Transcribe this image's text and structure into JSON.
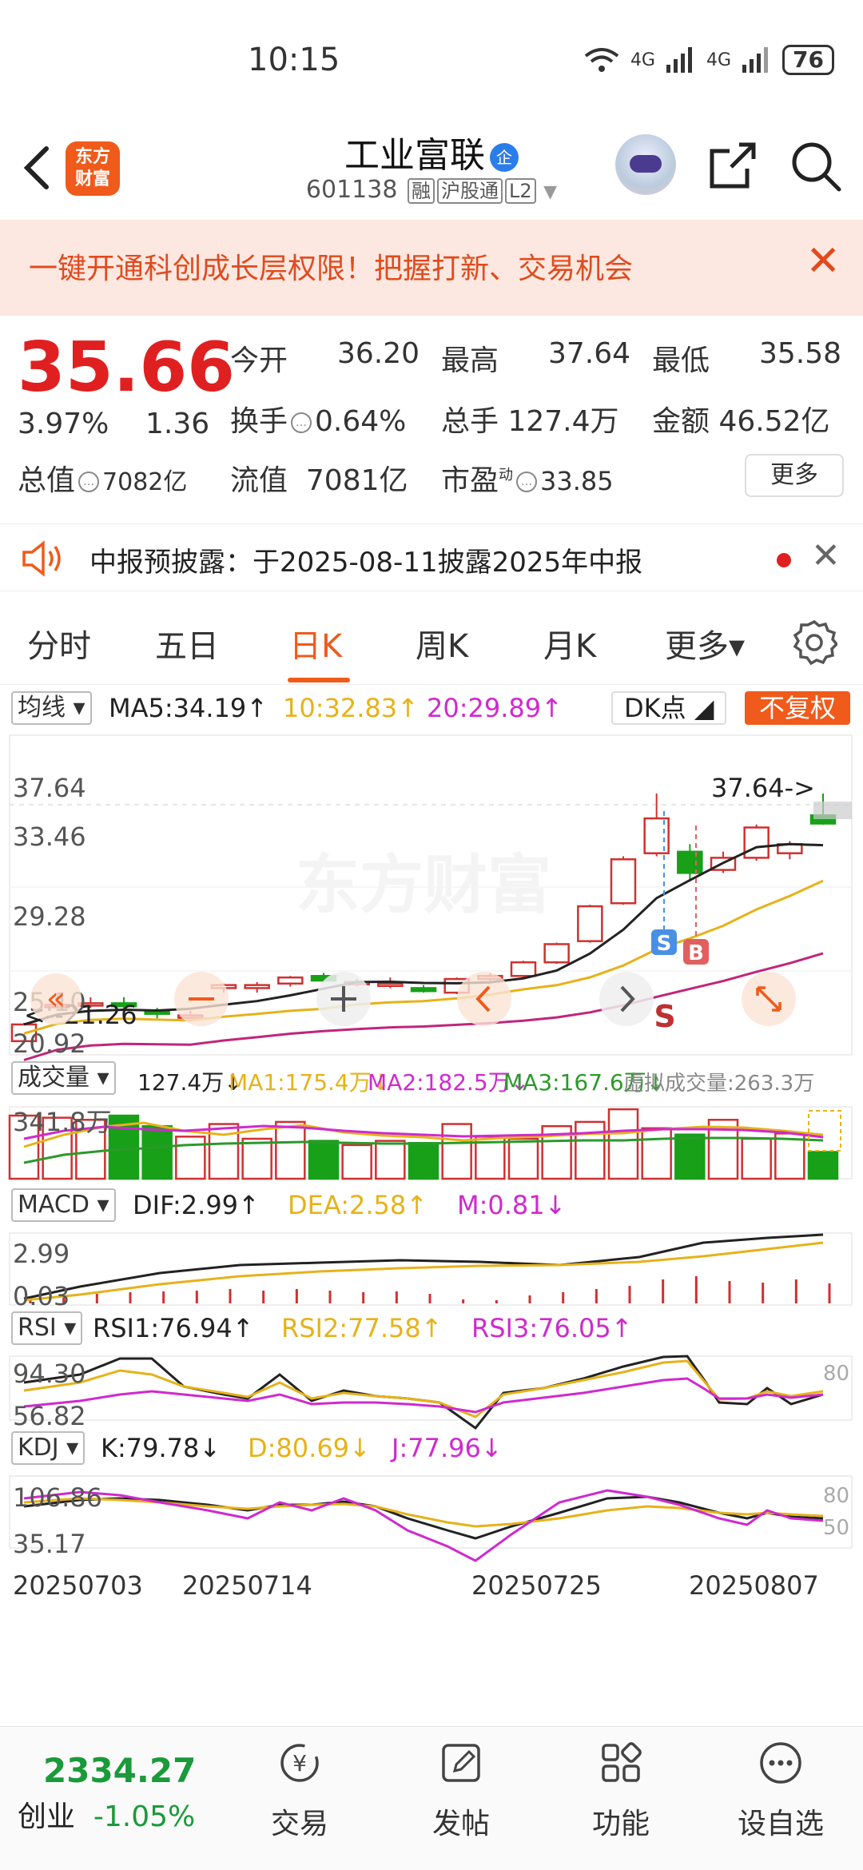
{
  "status": {
    "time": "10:15",
    "battery": "76",
    "net1": "4G",
    "net2": "4G"
  },
  "header": {
    "logo_line1": "东方",
    "logo_line2": "财富",
    "title": "工业富联",
    "badge": "企",
    "code": "601138",
    "tags": [
      "融",
      "沪股通",
      "L2"
    ]
  },
  "banner": {
    "text": "一键开通科创成长层权限！把握打新、交易机会",
    "close": "✕"
  },
  "quote": {
    "price": "35.66",
    "pct": "3.97%",
    "change": "1.36",
    "open_label": "今开",
    "open": "36.20",
    "high_label": "最高",
    "high": "37.64",
    "low_label": "最低",
    "low": "35.58",
    "turnover_label": "换手",
    "turnover": "0.64%",
    "volume_label": "总手",
    "volume": "127.4万",
    "amount_label": "金额",
    "amount": "46.52亿",
    "mktcap_label": "总值",
    "mktcap": "7082亿",
    "float_label": "流值",
    "float": "7081亿",
    "pe_label": "市盈",
    "pe_sup": "动",
    "pe": "33.85",
    "more": "更多"
  },
  "notice": {
    "text": "中报预披露：于2025-08-11披露2025年中报"
  },
  "tabs": [
    {
      "label": "分时"
    },
    {
      "label": "五日"
    },
    {
      "label": "日K"
    },
    {
      "label": "周K"
    },
    {
      "label": "月K"
    },
    {
      "label": "更多▾"
    }
  ],
  "chart": {
    "ma_select": "均线",
    "ma5": "MA5:34.19↑",
    "ma10": "10:32.83↑",
    "ma20": "20:29.89↑",
    "dk": "DK点",
    "fq": "不复权",
    "price_ticks": [
      "37.64",
      "33.46",
      "29.28",
      "25.10",
      "20.92"
    ],
    "high_annot": "37.64->",
    "low_annot": "<--21.26",
    "vol_select": "成交量",
    "vol": "127.4万↓",
    "vma1": "MA1:175.4万↓",
    "vma2": "MA2:182.5万↓",
    "vma3": "MA3:167.6万↓",
    "vvol": "虚拟成交量:263.3万",
    "vol_tick": "341.8万",
    "macd_select": "MACD",
    "dif": "DIF:2.99↑",
    "dea": "DEA:2.58↑",
    "m": "M:0.81↓",
    "macd_ticks": [
      "2.99",
      "0.03"
    ],
    "rsi_select": "RSI",
    "rsi1": "RSI1:76.94↑",
    "rsi2": "RSI2:77.58↑",
    "rsi3": "RSI3:76.05↑",
    "rsi_ticks": [
      "94.30",
      "56.82"
    ],
    "rsi_ref": "80",
    "kdj_select": "KDJ",
    "k": "K:79.78↓",
    "d": "D:80.69↓",
    "j": "J:77.96↓",
    "kdj_ticks": [
      "106.86",
      "35.17"
    ],
    "kdj_ref1": "80",
    "kdj_ref2": "50",
    "dates": [
      "20250703",
      "20250714",
      "20250725",
      "20250807"
    ],
    "watermark": "东方财富",
    "sig_s": "S",
    "sig_b": "B"
  },
  "chart_data": {
    "type": "candlestick",
    "ohlc": [
      [
        21.3,
        22.5,
        21.26,
        22.4
      ],
      [
        23.6,
        24.4,
        23.5,
        23.7
      ],
      [
        23.7,
        24.2,
        23.5,
        23.8
      ],
      [
        23.8,
        24.2,
        23.2,
        23.6
      ],
      [
        23.3,
        23.5,
        22.8,
        23.1
      ],
      [
        23.0,
        23.3,
        22.8,
        23.0
      ],
      [
        24.8,
        25.1,
        24.5,
        25.0
      ],
      [
        24.8,
        25.2,
        24.5,
        25.0
      ],
      [
        25.1,
        25.6,
        24.9,
        25.5
      ],
      [
        25.6,
        25.8,
        25.2,
        25.3
      ],
      [
        25.1,
        25.4,
        24.9,
        25.2
      ],
      [
        25.0,
        25.5,
        24.8,
        25.1
      ],
      [
        24.8,
        25.0,
        24.5,
        24.6
      ],
      [
        24.5,
        25.5,
        24.4,
        25.4
      ],
      [
        25.4,
        25.8,
        25.2,
        25.6
      ],
      [
        25.6,
        26.6,
        25.5,
        26.5
      ],
      [
        26.5,
        27.8,
        26.4,
        27.7
      ],
      [
        27.9,
        30.3,
        27.8,
        30.2
      ],
      [
        30.4,
        33.5,
        30.3,
        33.3
      ],
      [
        33.7,
        37.64,
        33.5,
        36.0
      ],
      [
        33.8,
        34.3,
        32.0,
        32.4
      ],
      [
        32.6,
        33.8,
        32.4,
        33.4
      ],
      [
        33.4,
        35.6,
        33.2,
        35.4
      ],
      [
        33.7,
        34.5,
        33.3,
        34.3
      ],
      [
        36.2,
        37.64,
        35.58,
        35.66
      ]
    ],
    "volume": [
      300,
      290,
      280,
      300,
      250,
      200,
      260,
      190,
      270,
      180,
      160,
      180,
      170,
      260,
      200,
      190,
      250,
      270,
      330,
      240,
      210,
      280,
      190,
      215,
      127.4
    ],
    "ma5": 34.19,
    "ma10": 32.83,
    "ma20": 29.89,
    "dif": 2.99,
    "dea": 2.58,
    "m": 0.81,
    "rsi1": 76.94,
    "rsi2": 77.58,
    "rsi3": 76.05,
    "k": 79.78,
    "d": 80.69,
    "j": 77.96
  },
  "bottom": {
    "index_value": "2334.27",
    "index_name": "创业",
    "index_pct": "-1.05%",
    "nav": [
      "交易",
      "发帖",
      "功能",
      "设自选"
    ]
  }
}
